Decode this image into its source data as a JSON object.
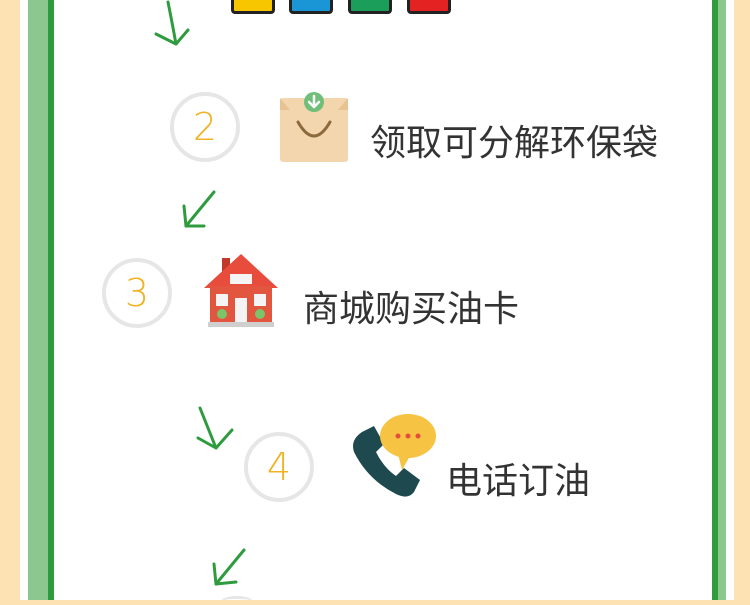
{
  "colors": {
    "background": "#fde2b4",
    "border_green": "#2e9b3e",
    "border_light_green": "#8bc78f",
    "number_color": "#f0b323",
    "circle_color": "#e6e6e6",
    "arrow_color": "#2e9b3e",
    "swatches": [
      "#f7c600",
      "#1a96d6",
      "#1a9e5a",
      "#e52222"
    ]
  },
  "steps": [
    {
      "number": "2",
      "label": "领取可分解环保袋",
      "icon": "bag-icon"
    },
    {
      "number": "3",
      "label": "商城购买油卡",
      "icon": "house-icon"
    },
    {
      "number": "4",
      "label": "电话订油",
      "icon": "phone-icon"
    }
  ]
}
